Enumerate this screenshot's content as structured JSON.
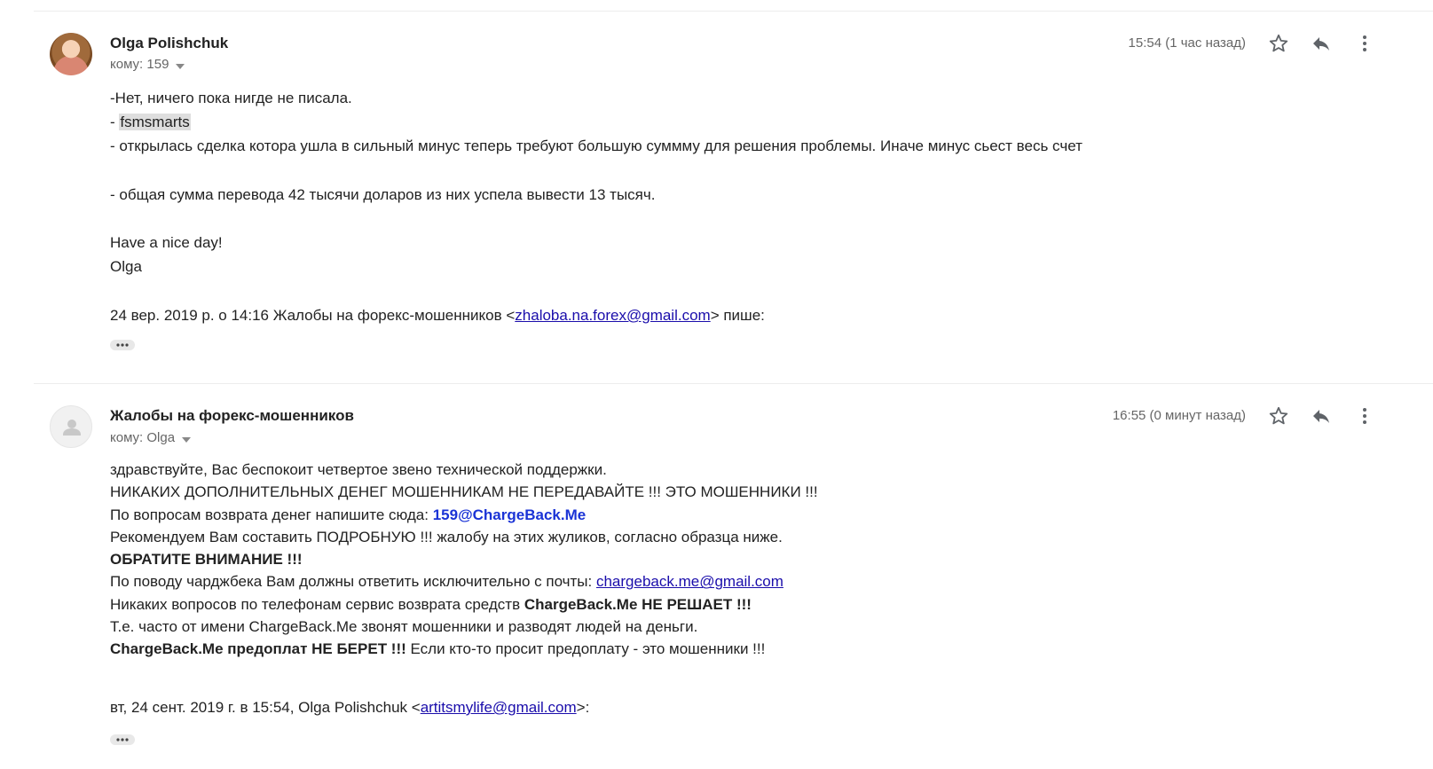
{
  "messages": [
    {
      "sender": "Olga Polishchuk",
      "to_label": "кому: 159",
      "time": "15:54 (1 час назад)",
      "avatar": "user-photo",
      "body": {
        "l1": "-Нет, ничего пока нигде не писала.",
        "l2_prefix": "- ",
        "l2_highlight": "fsmsmarts",
        "l3": "- открылась сделка котора ушла в сильный минус теперь требуют большую суммму для решения проблемы. Иначе минус сьест весь счет",
        "l4": "- общая сумма перевода 42 тысячи доларов из них успела вывести 13 тысяч.",
        "l5": "Have a nice day!",
        "l6": "Olga",
        "quote_prefix": "24 вер. 2019 р. о 14:16 Жалобы на форекс-мошенников <",
        "quote_email": "zhaloba.na.forex@gmail.com",
        "quote_suffix": "> пише:"
      }
    },
    {
      "sender": "Жалобы на форекс-мошенников",
      "to_label": "кому: Olga",
      "time": "16:55 (0 минут назад)",
      "avatar": "default-person",
      "body": {
        "l1": "здравствуйте, Вас беспокоит четвертое звено технической поддержки.",
        "l2": "НИКАКИХ ДОПОЛНИТЕЛЬНЫХ ДЕНЕГ МОШЕННИКАМ НЕ ПЕРЕДАВАЙТЕ !!! ЭТО МОШЕННИКИ !!!",
        "l3_prefix": "По вопросам возврата денег напишите сюда: ",
        "l3_email": "159@ChargeBack.Me",
        "l4": "Рекомендуем Вам составить ПОДРОБНУЮ !!! жалобу на этих жуликов, согласно образца ниже.",
        "l5": "ОБРАТИТЕ ВНИМАНИЕ !!!",
        "l6_prefix": "По поводу чарджбека Вам должны ответить исключительно с почты: ",
        "l6_email": "chargeback.me@gmail.com",
        "l7_prefix": "Никаких вопросов по телефонам сервис возврата средств ",
        "l7_bold": "ChargeBack.Me НЕ РЕШАЕТ !!!",
        "l8": "Т.е. часто от имени ChargeBack.Me звонят мошенники и разводят людей на деньги.",
        "l9_bold": "ChargeBack.Me предоплат НЕ БЕРЕТ !!!",
        "l9_suffix": " Если кто-то просит предоплату - это мошенники !!!",
        "quote_prefix": "вт, 24 сент. 2019 г. в 15:54, Olga Polishchuk <",
        "quote_email": "artitsmylife@gmail.com",
        "quote_suffix": ">:"
      }
    }
  ],
  "icons": {
    "star": "star-icon",
    "reply": "reply-icon",
    "more": "more-vert-icon",
    "caret": "caret-down-icon",
    "ellipsis": "show-trimmed-content-icon"
  },
  "colors": {
    "link": "#1a0dab",
    "bold_email": "#1a33d6",
    "meta_text": "#666666"
  }
}
